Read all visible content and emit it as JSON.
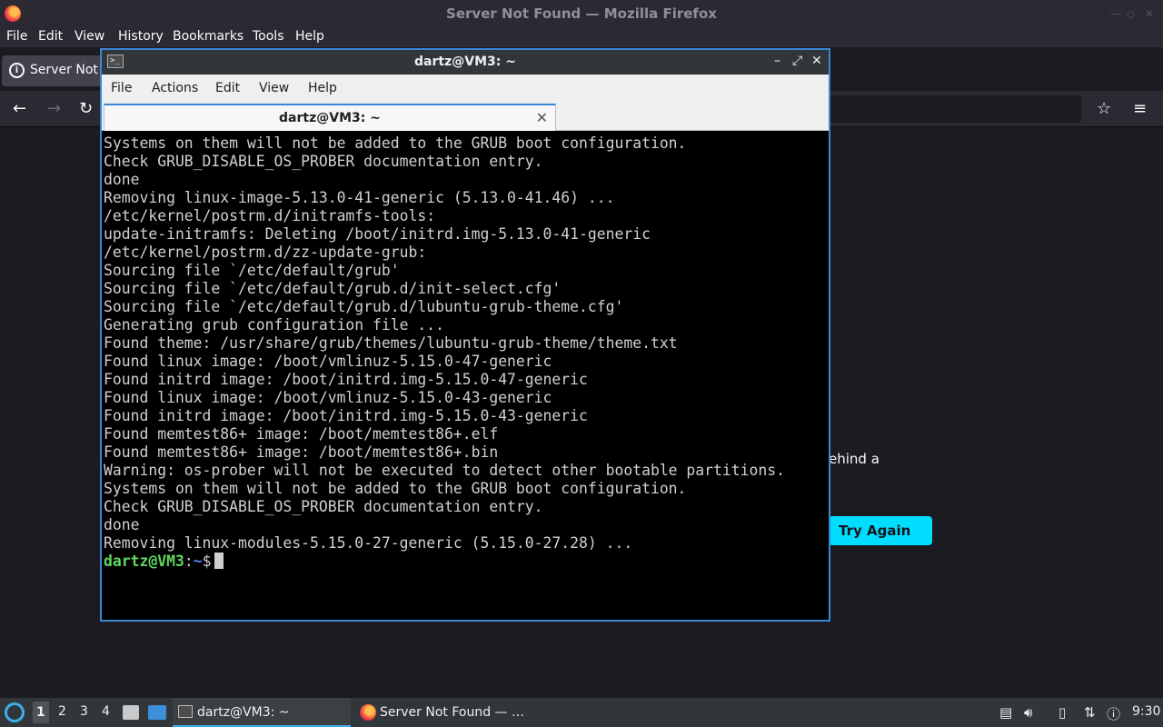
{
  "firefox": {
    "window_title": "Server Not Found — Mozilla Firefox",
    "menu": [
      "File",
      "Edit",
      "View",
      "History",
      "Bookmarks",
      "Tools",
      "Help"
    ],
    "tab_label": "Server Not F",
    "error_fragment": "ehind a",
    "try_again_label": "Try Again"
  },
  "terminal": {
    "window_title": "dartz@VM3: ~",
    "menu": [
      "File",
      "Actions",
      "Edit",
      "View",
      "Help"
    ],
    "tab_label": "dartz@VM3: ~",
    "lines": [
      "Systems on them will not be added to the GRUB boot configuration.",
      "Check GRUB_DISABLE_OS_PROBER documentation entry.",
      "done",
      "Removing linux-image-5.13.0-41-generic (5.13.0-41.46) ...",
      "/etc/kernel/postrm.d/initramfs-tools:",
      "update-initramfs: Deleting /boot/initrd.img-5.13.0-41-generic",
      "/etc/kernel/postrm.d/zz-update-grub:",
      "Sourcing file `/etc/default/grub'",
      "Sourcing file `/etc/default/grub.d/init-select.cfg'",
      "Sourcing file `/etc/default/grub.d/lubuntu-grub-theme.cfg'",
      "Generating grub configuration file ...",
      "Found theme: /usr/share/grub/themes/lubuntu-grub-theme/theme.txt",
      "Found linux image: /boot/vmlinuz-5.15.0-47-generic",
      "Found initrd image: /boot/initrd.img-5.15.0-47-generic",
      "Found linux image: /boot/vmlinuz-5.15.0-43-generic",
      "Found initrd image: /boot/initrd.img-5.15.0-43-generic",
      "Found memtest86+ image: /boot/memtest86+.elf",
      "Found memtest86+ image: /boot/memtest86+.bin",
      "Warning: os-prober will not be executed to detect other bootable partitions.",
      "Systems on them will not be added to the GRUB boot configuration.",
      "Check GRUB_DISABLE_OS_PROBER documentation entry.",
      "done",
      "Removing linux-modules-5.15.0-27-generic (5.15.0-27.28) ..."
    ],
    "prompt": {
      "user_host": "dartz@VM3",
      "separator": ":",
      "path": "~",
      "symbol": "$"
    }
  },
  "taskbar": {
    "desktops": [
      "1",
      "2",
      "3",
      "4"
    ],
    "tasks": [
      {
        "label": "dartz@VM3: ~",
        "icon": "terminal-icon",
        "active": true
      },
      {
        "label": "Server Not Found — …",
        "icon": "firefox-icon",
        "active": false
      }
    ],
    "clock": "9:30"
  },
  "colors": {
    "accent": "#3a87d6",
    "try_again": "#00ddff",
    "prompt_user": "#5fd75f",
    "prompt_path": "#5f87ff"
  }
}
